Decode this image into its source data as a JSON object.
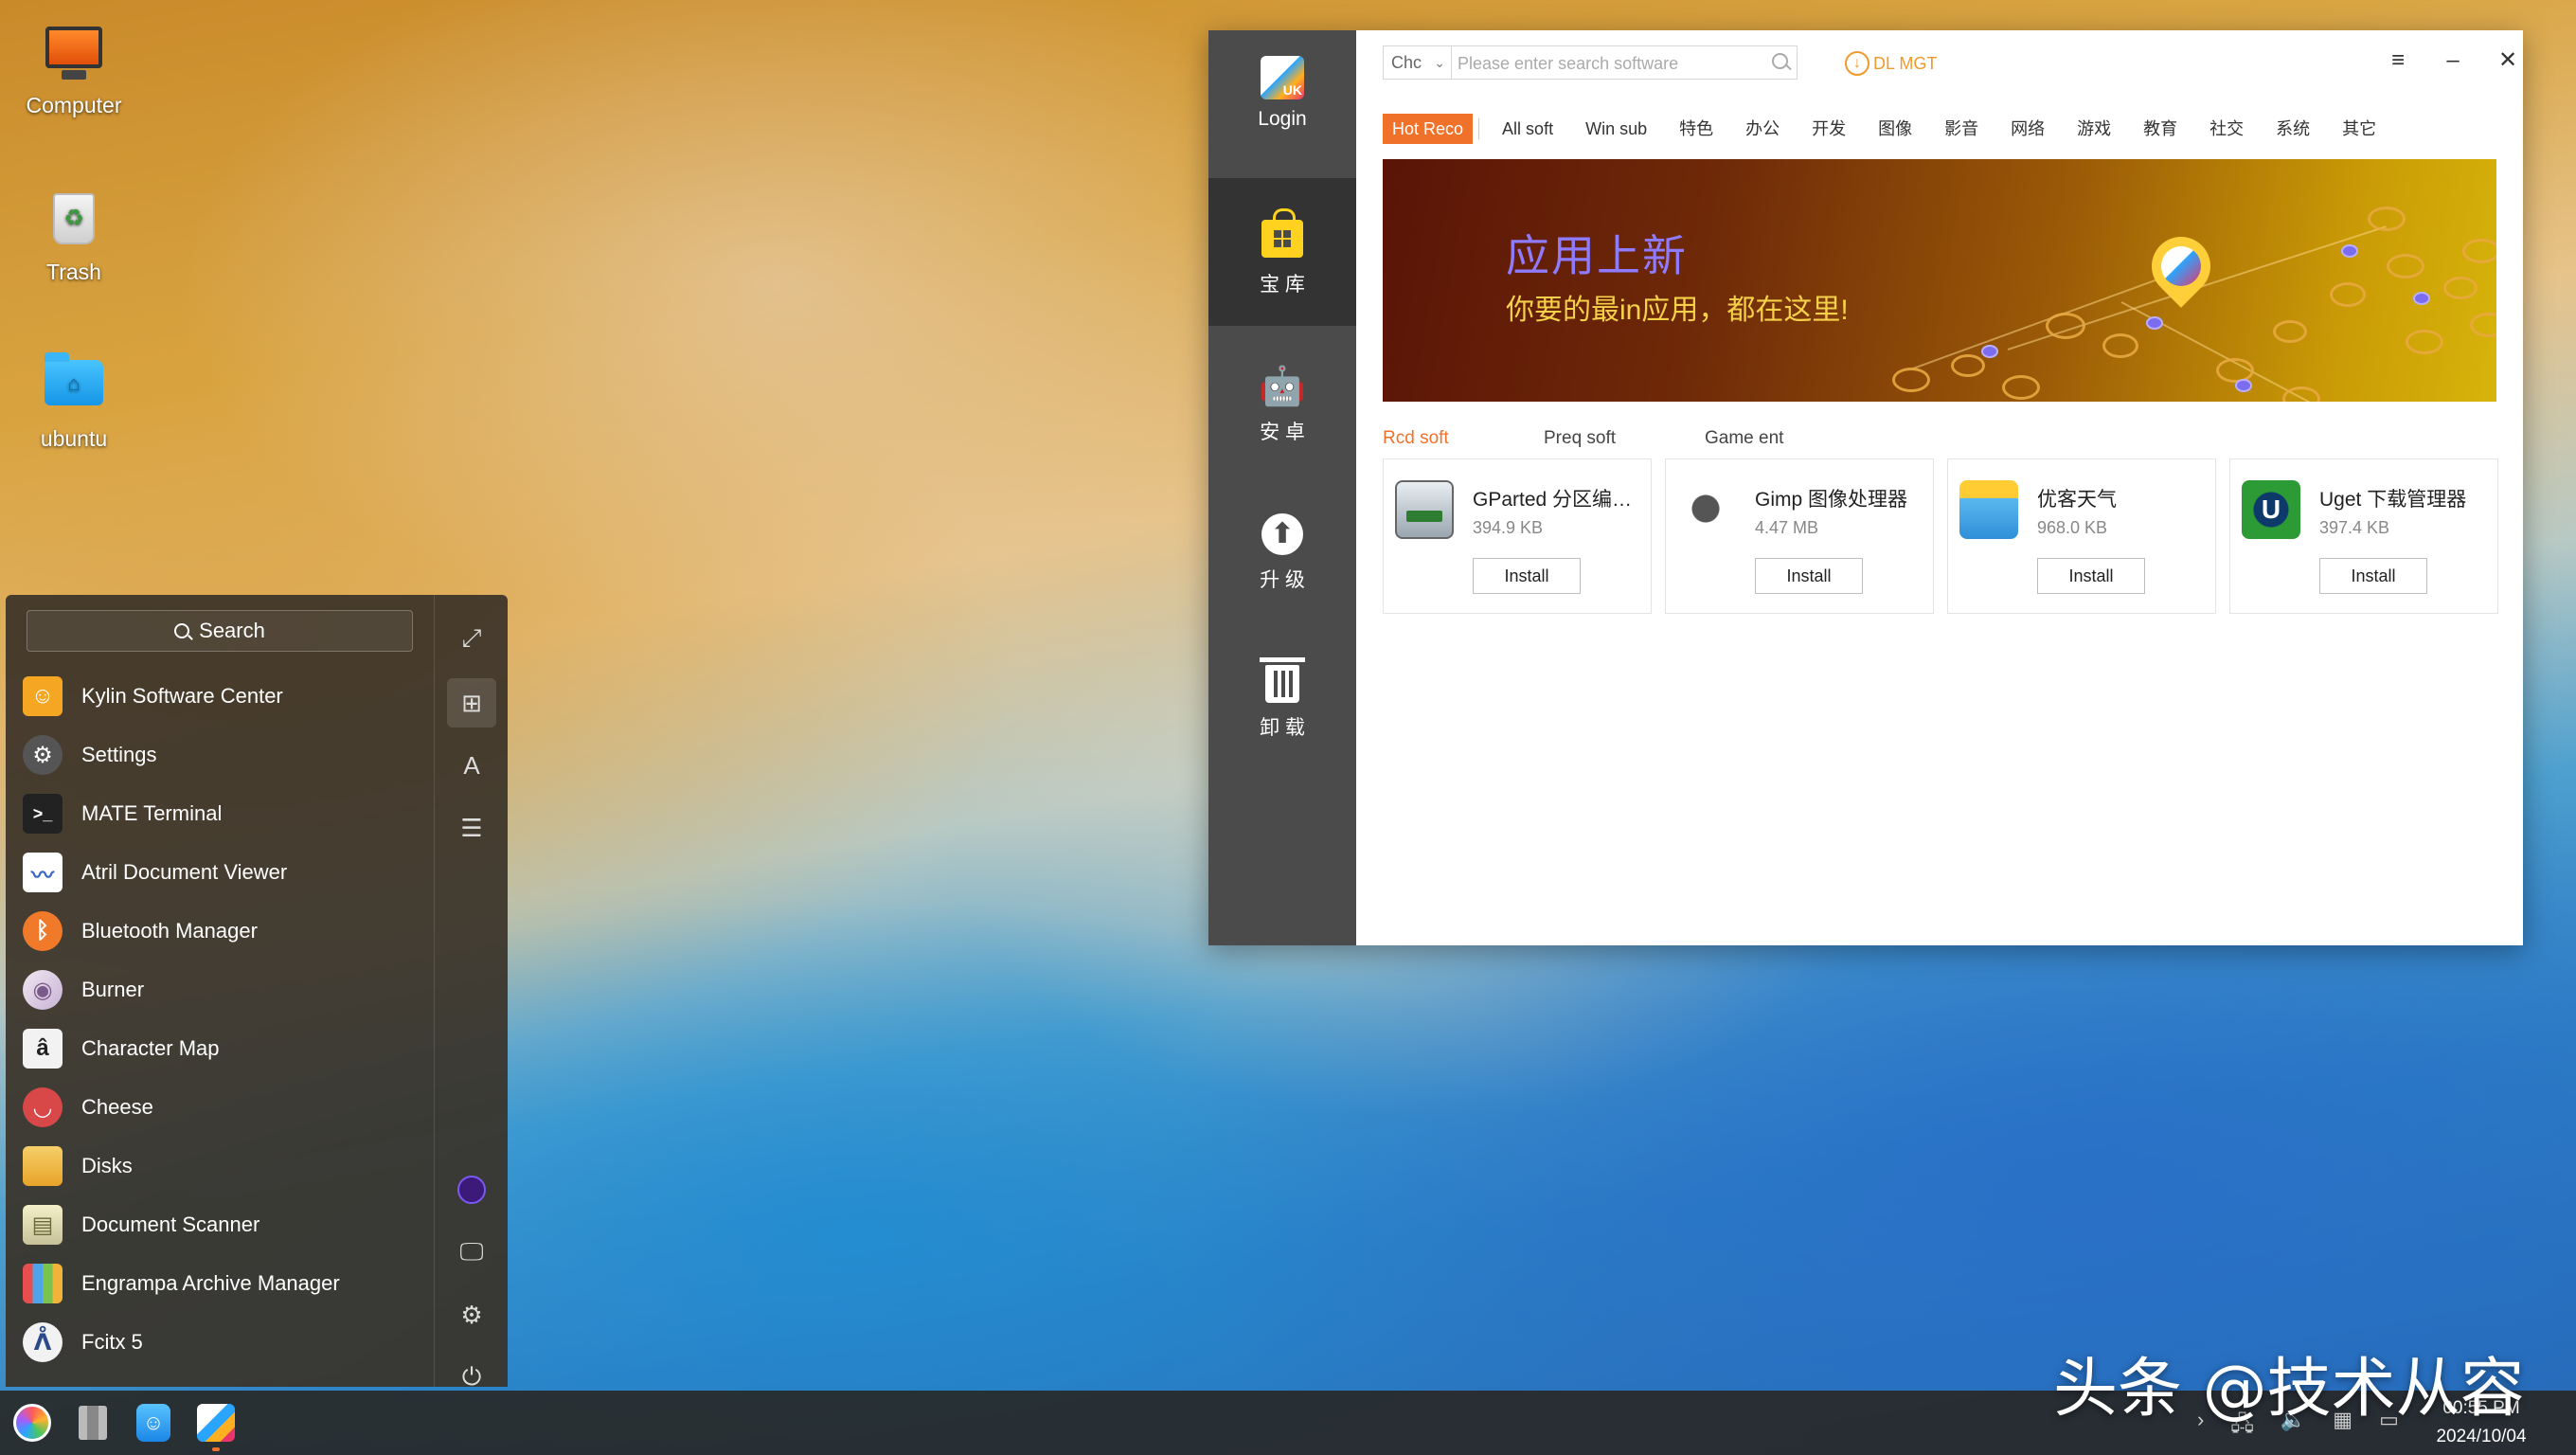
{
  "desktop": {
    "icons": [
      {
        "label": "Computer",
        "icon": "computer-icon"
      },
      {
        "label": "Trash",
        "icon": "trash-icon"
      },
      {
        "label": "ubuntu",
        "icon": "folder-icon"
      }
    ]
  },
  "software_center": {
    "sidebar": {
      "login": "Login",
      "store": "宝 库",
      "android": "安 卓",
      "upgrade": "升 级",
      "uninstall": "卸 载"
    },
    "search": {
      "category": "Chc",
      "placeholder": "Please enter search software"
    },
    "dl_mgt": "DL MGT",
    "tabs": [
      "Hot Reco",
      "All soft",
      "Win sub",
      "特色",
      "办公",
      "开发",
      "图像",
      "影音",
      "网络",
      "游戏",
      "教育",
      "社交",
      "系统",
      "其它"
    ],
    "banner": {
      "title": "应用上新",
      "subtitle": "你要的最in应用，都在这里!"
    },
    "sections": [
      "Rcd soft",
      "Preq soft",
      "Game ent"
    ],
    "apps": [
      {
        "name": "GParted 分区编…",
        "size": "394.9 KB",
        "action": "Install",
        "icon": "gparted-icon"
      },
      {
        "name": "Gimp 图像处理器",
        "size": "4.47 MB",
        "action": "Install",
        "icon": "gimp-icon"
      },
      {
        "name": "优客天气",
        "size": "968.0 KB",
        "action": "Install",
        "icon": "weather-icon"
      },
      {
        "name": "Uget 下载管理器",
        "size": "397.4 KB",
        "action": "Install",
        "icon": "uget-icon"
      }
    ]
  },
  "start_menu": {
    "search_label": "Search",
    "items": [
      {
        "label": "Kylin Software Center",
        "color": "#f5a623"
      },
      {
        "label": "Settings",
        "color": "#555555"
      },
      {
        "label": "MATE Terminal",
        "color": "#222222"
      },
      {
        "label": "Atril Document Viewer",
        "color": "#3a66c4"
      },
      {
        "label": "Bluetooth Manager",
        "color": "#f07a2a"
      },
      {
        "label": "Burner",
        "color": "#e8e0e8"
      },
      {
        "label": "Character Map",
        "color": "#f2f2f2"
      },
      {
        "label": "Cheese",
        "color": "#d94848"
      },
      {
        "label": "Disks",
        "color": "#f3b83a"
      },
      {
        "label": "Document Scanner",
        "color": "#e9e4b8"
      },
      {
        "label": "Engrampa Archive Manager",
        "color": "#7c5ab8"
      },
      {
        "label": "Fcitx 5",
        "color": "#f2f2f2"
      }
    ]
  },
  "taskbar": {
    "time": "00:55 PM",
    "date": "2024/10/04"
  },
  "watermark": "头条 @技术从容"
}
